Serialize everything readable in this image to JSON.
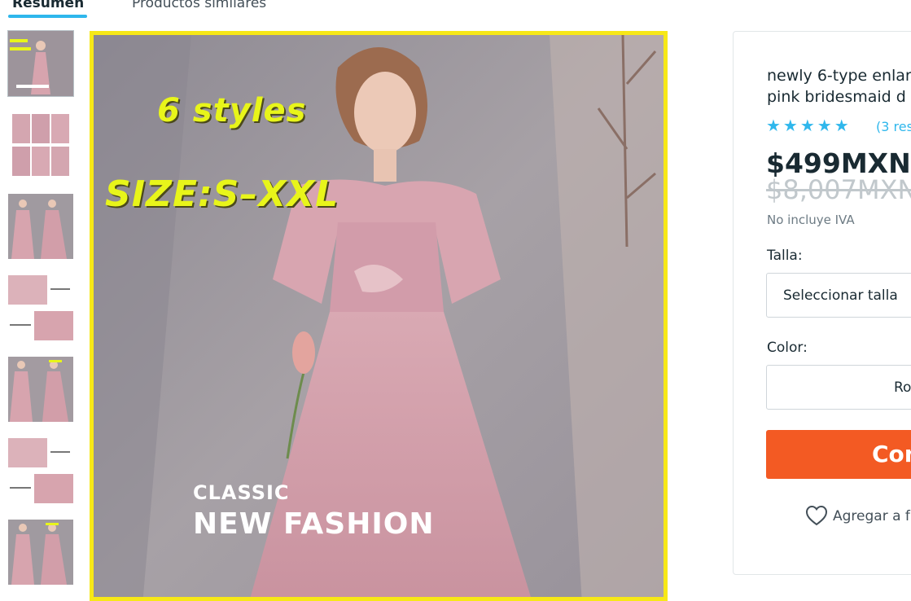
{
  "tabs": {
    "summary": "Resumen",
    "similar": "Productos similares"
  },
  "thumbnails": [
    {
      "name": "thumb-cover"
    },
    {
      "name": "thumb-grid"
    },
    {
      "name": "thumb-models"
    },
    {
      "name": "thumb-detail-a"
    },
    {
      "name": "thumb-styles"
    },
    {
      "name": "thumb-detail-b"
    },
    {
      "name": "thumb-full-length"
    }
  ],
  "image_overlay": {
    "styles": "6 styles",
    "size": "SIZE:S–XXL",
    "classic": "CLASSIC",
    "fashion": "NEW FASHION"
  },
  "product": {
    "title_line1": "newly 6-type enlar",
    "title_line2": "pink bridesmaid d",
    "rating": 4.5,
    "stars": "★★★★★",
    "reviews": "(3 res",
    "price": "$499MXN",
    "original_price": "$8,007MXN",
    "tax_note": "No incluye IVA",
    "size_label": "Talla:",
    "size_placeholder": "Seleccionar talla",
    "color_label": "Color:",
    "color_value": "Ro",
    "buy_label": "Con",
    "wishlist_label": "Agregar a f"
  },
  "colors": {
    "accent": "#2fb7ec",
    "buy_button": "#f35a23",
    "image_border": "#f7e817"
  }
}
